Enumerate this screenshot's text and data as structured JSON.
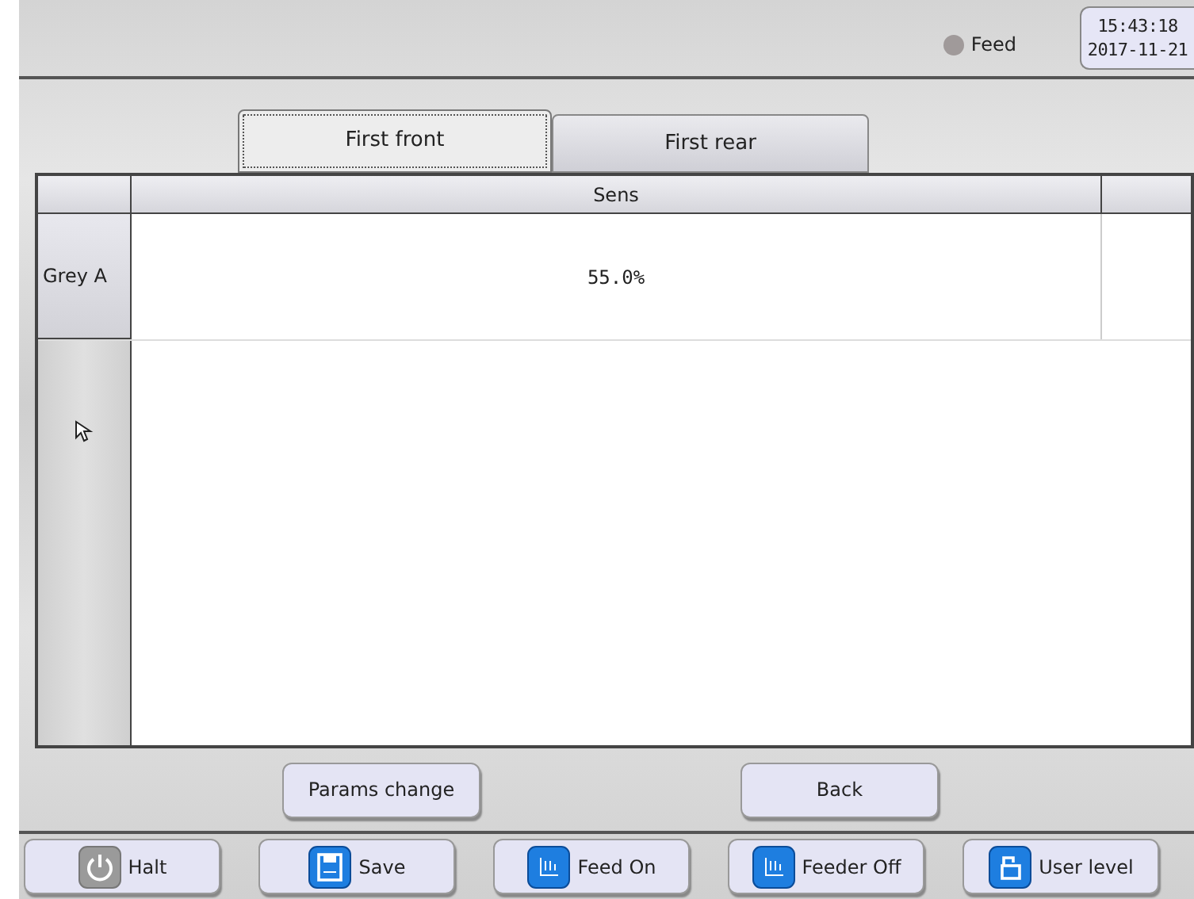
{
  "header": {
    "indicator": {
      "label": "Feed",
      "on": false
    },
    "time": "15:43:18",
    "date": "2017-11-21"
  },
  "tabs": [
    {
      "label": "First front",
      "selected": true
    },
    {
      "label": "First rear",
      "selected": false
    }
  ],
  "table": {
    "columns": [
      "Sens"
    ],
    "rows": [
      {
        "label": "Grey A",
        "values": [
          "55.0%"
        ]
      }
    ]
  },
  "actions": [
    "Params change",
    "Back"
  ],
  "toolbar": [
    {
      "label": "Halt",
      "kind": "power"
    },
    {
      "label": "Save",
      "kind": "save"
    },
    {
      "label": "Feed On",
      "kind": "feed"
    },
    {
      "label": "Feeder Off",
      "kind": "feed"
    },
    {
      "label": "User level",
      "kind": "lock"
    }
  ]
}
